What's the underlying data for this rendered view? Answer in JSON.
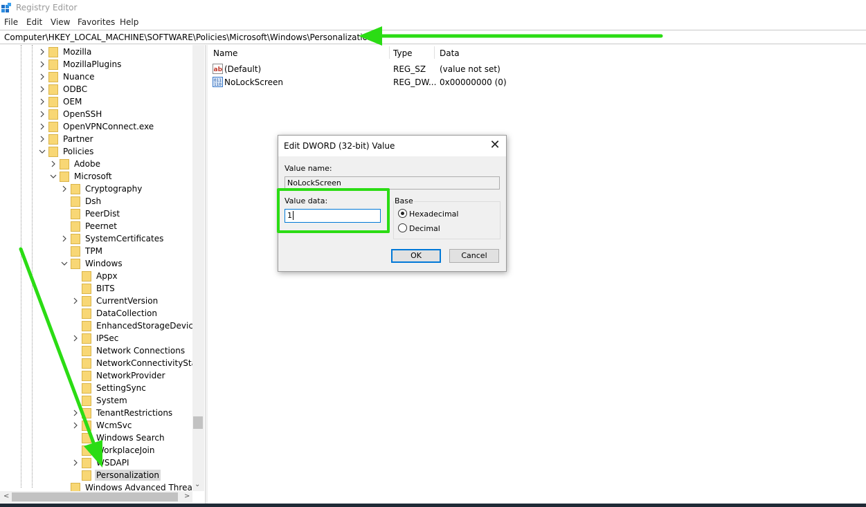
{
  "window": {
    "title": "Registry Editor"
  },
  "menu": [
    "File",
    "Edit",
    "View",
    "Favorites",
    "Help"
  ],
  "address": "Computer\\HKEY_LOCAL_MACHINE\\SOFTWARE\\Policies\\Microsoft\\Windows\\Personalization",
  "tree": {
    "items": [
      {
        "label": "Mozilla",
        "level": 0,
        "expander": "collapsed"
      },
      {
        "label": "MozillaPlugins",
        "level": 0,
        "expander": "collapsed"
      },
      {
        "label": "Nuance",
        "level": 0,
        "expander": "collapsed"
      },
      {
        "label": "ODBC",
        "level": 0,
        "expander": "collapsed"
      },
      {
        "label": "OEM",
        "level": 0,
        "expander": "collapsed"
      },
      {
        "label": "OpenSSH",
        "level": 0,
        "expander": "collapsed"
      },
      {
        "label": "OpenVPNConnect.exe",
        "level": 0,
        "expander": "collapsed"
      },
      {
        "label": "Partner",
        "level": 0,
        "expander": "collapsed"
      },
      {
        "label": "Policies",
        "level": 0,
        "expander": "expanded"
      },
      {
        "label": "Adobe",
        "level": 1,
        "expander": "collapsed"
      },
      {
        "label": "Microsoft",
        "level": 1,
        "expander": "expanded"
      },
      {
        "label": "Cryptography",
        "level": 2,
        "expander": "collapsed"
      },
      {
        "label": "Dsh",
        "level": 2,
        "expander": "none"
      },
      {
        "label": "PeerDist",
        "level": 2,
        "expander": "none"
      },
      {
        "label": "Peernet",
        "level": 2,
        "expander": "none"
      },
      {
        "label": "SystemCertificates",
        "level": 2,
        "expander": "collapsed"
      },
      {
        "label": "TPM",
        "level": 2,
        "expander": "none"
      },
      {
        "label": "Windows",
        "level": 2,
        "expander": "expanded"
      },
      {
        "label": "Appx",
        "level": 3,
        "expander": "none"
      },
      {
        "label": "BITS",
        "level": 3,
        "expander": "none"
      },
      {
        "label": "CurrentVersion",
        "level": 3,
        "expander": "collapsed"
      },
      {
        "label": "DataCollection",
        "level": 3,
        "expander": "none"
      },
      {
        "label": "EnhancedStorageDevices",
        "level": 3,
        "expander": "none"
      },
      {
        "label": "IPSec",
        "level": 3,
        "expander": "collapsed"
      },
      {
        "label": "Network Connections",
        "level": 3,
        "expander": "none"
      },
      {
        "label": "NetworkConnectivityStatu",
        "level": 3,
        "expander": "none"
      },
      {
        "label": "NetworkProvider",
        "level": 3,
        "expander": "none"
      },
      {
        "label": "SettingSync",
        "level": 3,
        "expander": "none"
      },
      {
        "label": "System",
        "level": 3,
        "expander": "none"
      },
      {
        "label": "TenantRestrictions",
        "level": 3,
        "expander": "collapsed"
      },
      {
        "label": "WcmSvc",
        "level": 3,
        "expander": "collapsed"
      },
      {
        "label": "Windows Search",
        "level": 3,
        "expander": "none"
      },
      {
        "label": "WorkplaceJoin",
        "level": 3,
        "expander": "none"
      },
      {
        "label": "WSDAPI",
        "level": 3,
        "expander": "collapsed"
      },
      {
        "label": "Personalization",
        "level": 3,
        "expander": "none",
        "selected": true
      },
      {
        "label": "Windows Advanced Threat Pr",
        "level": 2,
        "expander": "none"
      }
    ]
  },
  "list": {
    "columns": [
      "Name",
      "Type",
      "Data"
    ],
    "rows": [
      {
        "name": "(Default)",
        "type": "REG_SZ",
        "data": "(value not set)",
        "icon": "string-value-icon"
      },
      {
        "name": "NoLockScreen",
        "type": "REG_DW...",
        "data": "0x00000000 (0)",
        "icon": "binary-value-icon"
      }
    ]
  },
  "dialog": {
    "title": "Edit DWORD (32-bit) Value",
    "value_name_label": "Value name:",
    "value_name": "NoLockScreen",
    "value_data_label": "Value data:",
    "value_data": "1",
    "base_label": "Base",
    "base_options": [
      "Hexadecimal",
      "Decimal"
    ],
    "base_selected": "Hexadecimal",
    "ok_label": "OK",
    "cancel_label": "Cancel"
  },
  "colors": {
    "annotation_green": "#2bdc14",
    "focus_blue": "#0078d7",
    "folder_yellow": "#f8d775"
  }
}
